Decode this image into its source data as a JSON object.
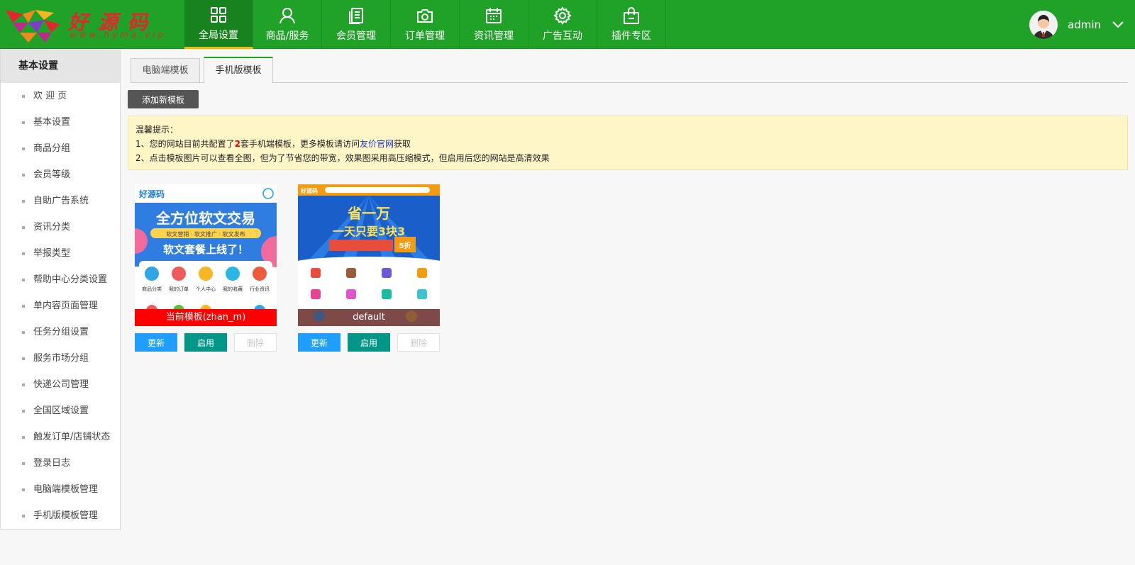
{
  "brand": {
    "name": "好源码",
    "url": "www.hyma.vip"
  },
  "nav": [
    {
      "label": "全局设置",
      "icon": "grid-icon",
      "active": true
    },
    {
      "label": "商品/服务",
      "icon": "user-icon"
    },
    {
      "label": "会员管理",
      "icon": "document-icon"
    },
    {
      "label": "订单管理",
      "icon": "camera-icon"
    },
    {
      "label": "资讯管理",
      "icon": "calendar-icon"
    },
    {
      "label": "广告互动",
      "icon": "gear-icon"
    },
    {
      "label": "插件专区",
      "icon": "bag-icon"
    }
  ],
  "user": {
    "name": "admin"
  },
  "sidebar": {
    "title": "基本设置",
    "items": [
      {
        "label": "欢 迎 页"
      },
      {
        "label": "基本设置"
      },
      {
        "label": "商品分组"
      },
      {
        "label": "会员等级"
      },
      {
        "label": "自助广告系统"
      },
      {
        "label": "资讯分类"
      },
      {
        "label": "举报类型"
      },
      {
        "label": "帮助中心分类设置"
      },
      {
        "label": "单内容页面管理"
      },
      {
        "label": "任务分组设置"
      },
      {
        "label": "服务市场分组"
      },
      {
        "label": "快递公司管理"
      },
      {
        "label": "全国区域设置"
      },
      {
        "label": "触发订单/店铺状态"
      },
      {
        "label": "登录日志"
      },
      {
        "label": "电脑端模板管理"
      },
      {
        "label": "手机版模板管理"
      }
    ]
  },
  "tabs": [
    {
      "label": "电脑端模板"
    },
    {
      "label": "手机版模板",
      "active": true
    }
  ],
  "add_button": "添加新模板",
  "tip": {
    "title": "温馨提示：",
    "line1_prefix": "1、您的网站目前共配置了",
    "line1_count": "2",
    "line1_mid": "套手机端模板，更多模板请访问",
    "line1_link": "友价官网",
    "line1_suffix": "获取",
    "line2": "2、点击模板图片可以查看全图，但为了节省您的带宽，效果图采用高压缩模式，但启用后您的网站是高清效果"
  },
  "templates": [
    {
      "label": "当前模板(zhan_m)",
      "label_color": "#ff0000",
      "thumb": {
        "banner_line1": "全方位软文交易",
        "banner_line2": "软文营销 · 软文推广 · 软文发布",
        "banner_line3": "软文套餐上线了！",
        "icons": [
          "商品分类",
          "我的订单",
          "个人中心",
          "我的收藏",
          "行业资讯"
        ]
      },
      "buttons": {
        "update": "更新",
        "enable": "启用",
        "delete": "删除"
      }
    },
    {
      "label": "default",
      "label_color": "#555555",
      "thumb": {
        "banner_line1": "省一万",
        "banner_line2": "一天只要3块3",
        "banner_line3": "5折"
      },
      "buttons": {
        "update": "更新",
        "enable": "启用",
        "delete": "删除"
      }
    }
  ],
  "colors": {
    "header": "#20a229",
    "active_nav": "#17821e",
    "accent": "#ffb800",
    "primary": "#1e9fff",
    "teal": "#009688",
    "tip_bg": "#fff6c7"
  }
}
